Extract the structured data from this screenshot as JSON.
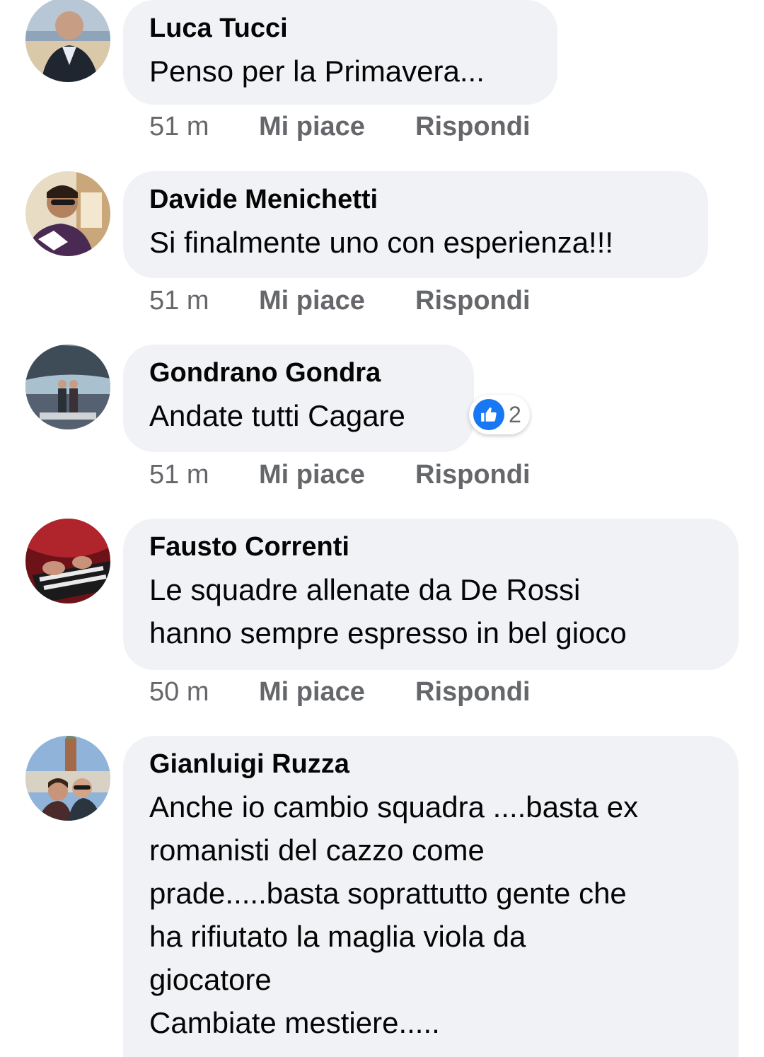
{
  "comments": [
    {
      "author": "Luca Tucci",
      "text": "Penso per la Primavera...",
      "time": "51 m",
      "like_label": "Mi piace",
      "reply_label": "Rispondi",
      "avatar_icon": "user-avatar-icon"
    },
    {
      "author": "Davide Menichetti",
      "text": "Si finalmente uno con esperienza!!!",
      "time": "51 m",
      "like_label": "Mi piace",
      "reply_label": "Rispondi",
      "avatar_icon": "user-avatar-icon"
    },
    {
      "author": "Gondrano Gondra",
      "text": "Andate tutti Cagare",
      "time": "51 m",
      "like_label": "Mi piace",
      "reply_label": "Rispondi",
      "avatar_icon": "user-avatar-icon",
      "reaction": {
        "icon": "thumbs-up-icon",
        "count": "2",
        "color": "#1877f2"
      }
    },
    {
      "author": "Fausto Correnti",
      "text": "Le squadre allenate da De Rossi\nhanno sempre espresso in bel gioco",
      "time": "50 m",
      "like_label": "Mi piace",
      "reply_label": "Rispondi",
      "avatar_icon": "user-avatar-icon"
    },
    {
      "author": "Gianluigi Ruzza",
      "text": "Anche io cambio squadra ....basta ex\nromanisti del cazzo come\nprade.....basta soprattutto gente che\nha rifiutato la maglia viola da\ngiocatore\nCambiate mestiere.....",
      "avatar_icon": "user-avatar-icon"
    }
  ],
  "colors": {
    "bubble_bg": "#f0f2f5",
    "action_text": "#65676b",
    "primary_text": "#050505",
    "like_blue": "#1877f2"
  }
}
